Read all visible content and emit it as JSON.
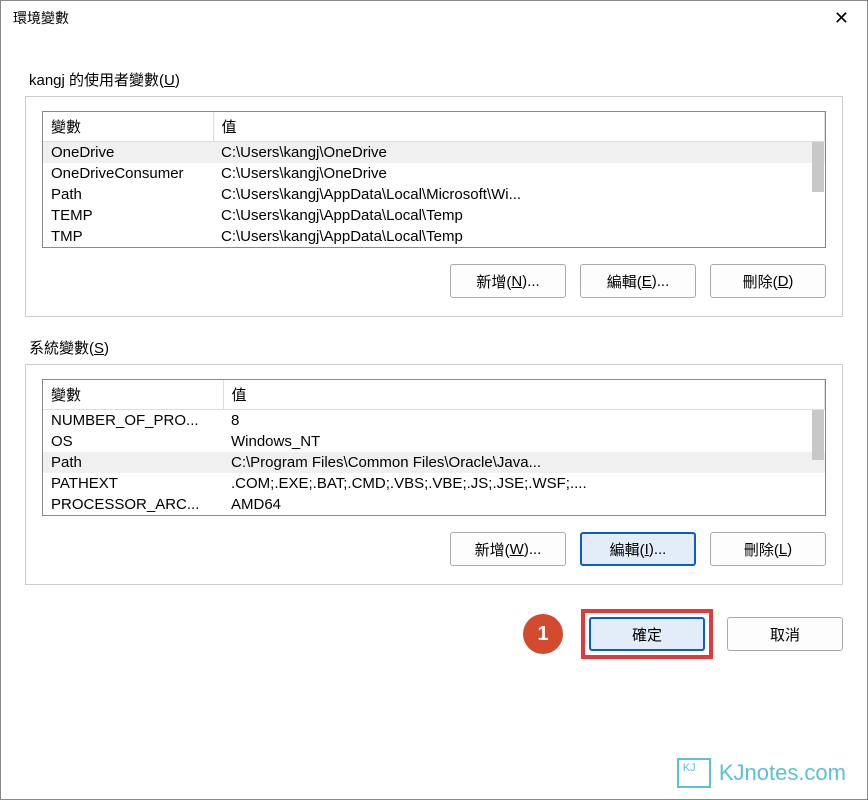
{
  "window": {
    "title": "環境變數"
  },
  "userSection": {
    "label_prefix": "kangj 的使用者變數(",
    "label_key": "U",
    "label_suffix": ")",
    "headers": {
      "var": "變數",
      "val": "值"
    },
    "rows": [
      {
        "var": "OneDrive",
        "val": "C:\\Users\\kangj\\OneDrive",
        "selected": true
      },
      {
        "var": "OneDriveConsumer",
        "val": "C:\\Users\\kangj\\OneDrive"
      },
      {
        "var": "Path",
        "val": "C:\\Users\\kangj\\AppData\\Local\\Microsoft\\Wi..."
      },
      {
        "var": "TEMP",
        "val": "C:\\Users\\kangj\\AppData\\Local\\Temp"
      },
      {
        "var": "TMP",
        "val": "C:\\Users\\kangj\\AppData\\Local\\Temp"
      }
    ],
    "buttons": {
      "new_prefix": "新增(",
      "new_key": "N",
      "new_suffix": ")...",
      "edit_prefix": "編輯(",
      "edit_key": "E",
      "edit_suffix": ")...",
      "del_prefix": "刪除(",
      "del_key": "D",
      "del_suffix": ")"
    }
  },
  "sysSection": {
    "label_prefix": "系統變數(",
    "label_key": "S",
    "label_suffix": ")",
    "headers": {
      "var": "變數",
      "val": "值"
    },
    "rows": [
      {
        "var": "NUMBER_OF_PRO...",
        "val": "8"
      },
      {
        "var": "OS",
        "val": "Windows_NT"
      },
      {
        "var": "Path",
        "val": "C:\\Program Files\\Common Files\\Oracle\\Java...",
        "selected": true
      },
      {
        "var": "PATHEXT",
        "val": ".COM;.EXE;.BAT;.CMD;.VBS;.VBE;.JS;.JSE;.WSF;...."
      },
      {
        "var": "PROCESSOR_ARC...",
        "val": "AMD64"
      }
    ],
    "buttons": {
      "new_prefix": "新增(",
      "new_key": "W",
      "new_suffix": ")...",
      "edit_prefix": "編輯(",
      "edit_key": "I",
      "edit_suffix": ")...",
      "del_prefix": "刪除(",
      "del_key": "L",
      "del_suffix": ")"
    }
  },
  "dialog": {
    "badge": "1",
    "ok": "確定",
    "cancel": "取消"
  },
  "watermark": "KJnotes.com"
}
